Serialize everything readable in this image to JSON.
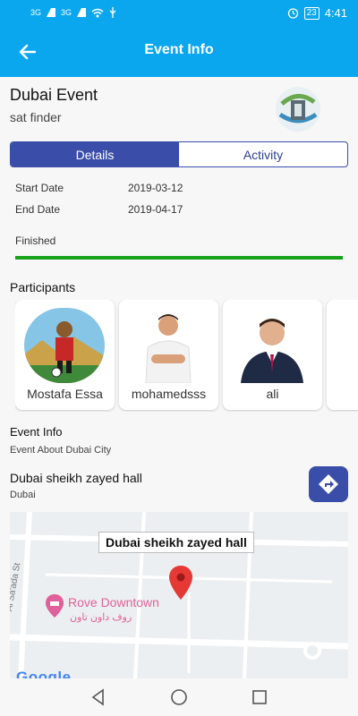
{
  "status_bar": {
    "carrier1": "3G",
    "carrier2": "3G",
    "battery": "23",
    "time": "4:41"
  },
  "app_bar": {
    "title": "Event Info",
    "back_icon": "arrow-back-icon"
  },
  "event": {
    "title": "Dubai Event",
    "subtitle": "sat finder"
  },
  "tabs": [
    {
      "label": "Details",
      "active": true
    },
    {
      "label": "Activity",
      "active": false
    }
  ],
  "details": {
    "start_label": "Start Date",
    "start_value": "2019-03-12",
    "end_label": "End Date",
    "end_value": "2019-04-17",
    "status": "Finished",
    "progress": 1.0
  },
  "participants": {
    "heading": "Participants",
    "items": [
      {
        "name": "Mostafa Essa"
      },
      {
        "name": "mohamedsss"
      },
      {
        "name": "ali"
      }
    ]
  },
  "event_info": {
    "heading": "Event Info",
    "description": "Event About Dubai City",
    "venue": "Dubai sheikh zayed hall",
    "city": "Dubai"
  },
  "map": {
    "callout": "Dubai sheikh zayed hall",
    "poi": "Rove Downtown",
    "poi_ar": "روف داون تاون",
    "street": "Al Sa'ada St",
    "attribution": "Google"
  },
  "colors": {
    "primary": "#0aa7ee",
    "accent": "#3a4ea9",
    "progress": "#19a31d"
  }
}
